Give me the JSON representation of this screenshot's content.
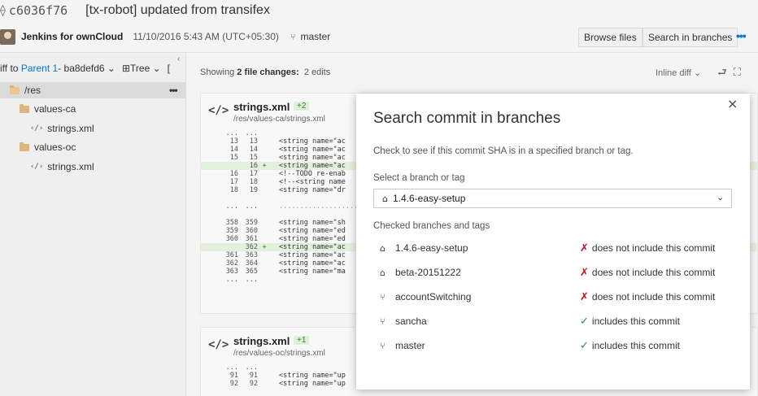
{
  "header": {
    "commit_icon": "commit-icon",
    "commit_id": "c6036f76",
    "commit_title": "[tx-robot] updated from transifex",
    "author": "Jenkins for ownCloud",
    "date": "11/10/2016 5:43 AM (UTC+05:30)",
    "branch_icon": "branch-icon",
    "branch": "master",
    "browse_files": "Browse files",
    "search_in_branches": "Search in branches",
    "more": "•••"
  },
  "sidebar": {
    "diff_prefix": "iff to",
    "parent_link": "Parent 1",
    "parent_sha": " - ba8defd6 ⌄",
    "tree_label": "Tree ⌄",
    "tree_extra": "[",
    "items": [
      {
        "label": "/res",
        "type": "folder"
      },
      {
        "label": "values-ca",
        "type": "folder"
      },
      {
        "label": "strings.xml",
        "type": "file"
      },
      {
        "label": "values-oc",
        "type": "folder"
      },
      {
        "label": "strings.xml",
        "type": "file"
      }
    ],
    "more": "•••"
  },
  "main": {
    "showing_prefix": "Showing",
    "showing_count": "2 file changes:",
    "showing_suffix": "2 edits",
    "inline_diff": "Inline diff ⌄",
    "files": [
      {
        "tag": "</>",
        "name": "strings.xml",
        "badge": "+2",
        "path": "/res/values-ca/strings.xml",
        "lines": [
          {
            "a": "...",
            "b": "...",
            "m": "",
            "t": "",
            "kind": "sep"
          },
          {
            "a": "13",
            "b": "13",
            "m": "",
            "t": "<string name=\"ac",
            "kind": ""
          },
          {
            "a": "14",
            "b": "14",
            "m": "",
            "t": "<string name=\"ac",
            "kind": ""
          },
          {
            "a": "15",
            "b": "15",
            "m": "",
            "t": "<string name=\"ac",
            "kind": ""
          },
          {
            "a": "",
            "b": "16",
            "m": "+",
            "t": "<string name=\"ac",
            "kind": "add"
          },
          {
            "a": "16",
            "b": "17",
            "m": "",
            "t": "<!--TODO re-enab",
            "kind": ""
          },
          {
            "a": "17",
            "b": "18",
            "m": "",
            "t": "<!--<string name",
            "kind": ""
          },
          {
            "a": "18",
            "b": "19",
            "m": "",
            "t": "<string name=\"dr",
            "kind": ""
          },
          {
            "a": "",
            "b": "",
            "m": "",
            "t": "",
            "kind": "blank"
          },
          {
            "a": "...",
            "b": "...",
            "m": "",
            "t": "..................................",
            "kind": "sep"
          },
          {
            "a": "",
            "b": "",
            "m": "",
            "t": "",
            "kind": "blank"
          },
          {
            "a": "358",
            "b": "359",
            "m": "",
            "t": "<string name=\"sh",
            "kind": ""
          },
          {
            "a": "359",
            "b": "360",
            "m": "",
            "t": "<string name=\"ed",
            "kind": ""
          },
          {
            "a": "360",
            "b": "361",
            "m": "",
            "t": "<string name=\"ed",
            "kind": ""
          },
          {
            "a": "",
            "b": "362",
            "m": "+",
            "t": "<string name=\"ac",
            "kind": "add"
          },
          {
            "a": "361",
            "b": "363",
            "m": "",
            "t": "<string name=\"ac",
            "kind": ""
          },
          {
            "a": "362",
            "b": "364",
            "m": "",
            "t": "<string name=\"ac",
            "kind": ""
          },
          {
            "a": "363",
            "b": "365",
            "m": "",
            "t": "<string name=\"ma",
            "kind": ""
          },
          {
            "a": "...",
            "b": "...",
            "m": "",
            "t": "",
            "kind": "sep"
          }
        ]
      },
      {
        "tag": "</>",
        "name": "strings.xml",
        "badge": "+1",
        "path": "/res/values-oc/strings.xml",
        "lines": [
          {
            "a": "...",
            "b": "...",
            "m": "",
            "t": "",
            "kind": "sep"
          },
          {
            "a": "91",
            "b": "91",
            "m": "",
            "t": "<string name=\"up",
            "kind": ""
          },
          {
            "a": "92",
            "b": "92",
            "m": "",
            "t": "<string name=\"up",
            "kind": ""
          }
        ]
      }
    ]
  },
  "dialog": {
    "close": "×",
    "title": "Search commit in branches",
    "description": "Check to see if this commit SHA is in a specified branch or tag.",
    "select_label": "Select a branch or tag",
    "selected_value": "1.4.6-easy-setup",
    "checked_label": "Checked branches and tags",
    "results": [
      {
        "name": "1.4.6-easy-setup",
        "kind": "tag",
        "included": false,
        "status": "does not include this commit"
      },
      {
        "name": "beta-20151222",
        "kind": "tag",
        "included": false,
        "status": "does not include this commit"
      },
      {
        "name": "accountSwitching",
        "kind": "branch",
        "included": false,
        "status": "does not include this commit"
      },
      {
        "name": "sancha",
        "kind": "branch",
        "included": true,
        "status": "includes this commit"
      },
      {
        "name": "master",
        "kind": "branch",
        "included": true,
        "status": "includes this commit"
      }
    ],
    "colors": {
      "included": "#2e8b3a",
      "not_included": "#c50f1f",
      "accent": "#0078d7"
    }
  }
}
